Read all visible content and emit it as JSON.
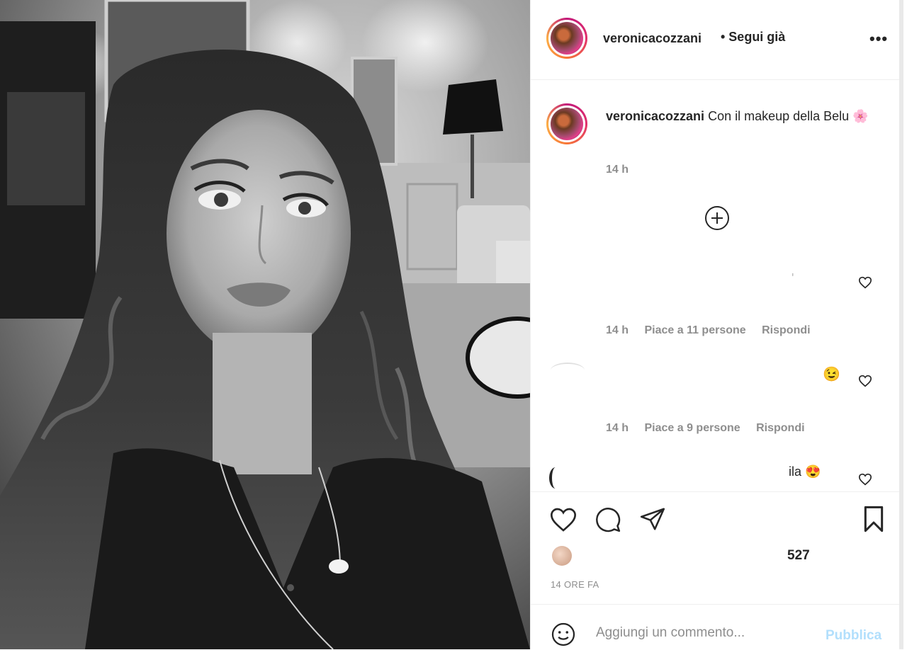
{
  "post": {
    "username": "veronicacozzani",
    "follow_label": "• Segui già",
    "more_label": "•••",
    "caption_user": "veronicacozzani",
    "caption_text": "Con il makeup della Belu",
    "caption_emoji": "🌸",
    "caption_time": "14 h"
  },
  "comments": [
    {
      "time": "14 h",
      "likes": "Piace a 11 persone",
      "reply": "Rispondi",
      "fragment": "'"
    },
    {
      "time": "14 h",
      "likes": "Piace a 9 persone",
      "reply": "Rispondi",
      "fragment": "😉"
    },
    {
      "fragment": "ila 😍"
    }
  ],
  "actions": {
    "likes_count": "527",
    "likes_fragment": "5̶27",
    "posted_ago": "14 ORE FA"
  },
  "comment_box": {
    "placeholder": "Aggiungi un commento...",
    "publish_label": "Pubblica"
  },
  "icons": {
    "like": "heart-icon",
    "comment": "comment-icon",
    "share": "send-icon",
    "save": "bookmark-icon",
    "emoji": "emoji-icon",
    "add": "plus-circle-icon"
  },
  "colors": {
    "publish_disabled": "#b2dffc",
    "secondary_text": "#8e8e8e",
    "primary_text": "#262626"
  }
}
